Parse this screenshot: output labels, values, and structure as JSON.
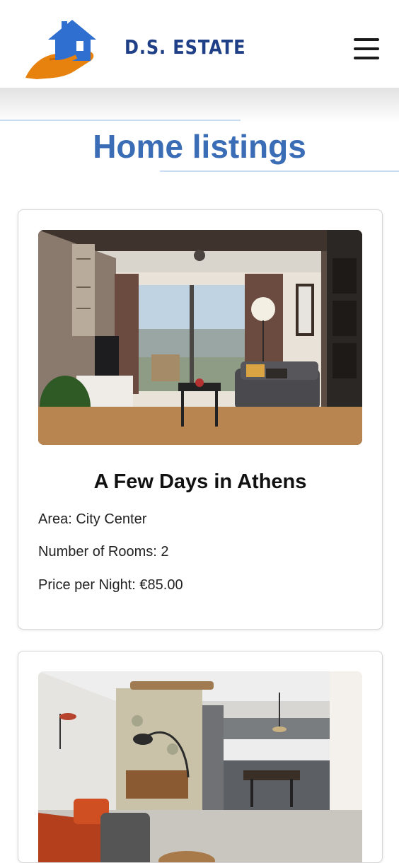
{
  "header": {
    "brand": "D.S. ESTATE",
    "logo_icon": "house-in-hand-icon",
    "menu_icon": "hamburger-menu-icon"
  },
  "page": {
    "title": "Home listings"
  },
  "listings": [
    {
      "image_icon": "living-room-photo",
      "title": "A Few Days in Athens",
      "area": "Area: City Center",
      "rooms": "Number of Rooms: 2",
      "price": "Price per Night: €85.00"
    },
    {
      "image_icon": "living-kitchen-photo"
    }
  ],
  "colors": {
    "brand_text": "#1f3f86",
    "title_blue": "#3a6db5",
    "logo_house": "#2f6fd0",
    "logo_hand": "#e8820f",
    "deco_line": "#c9dcf4"
  }
}
